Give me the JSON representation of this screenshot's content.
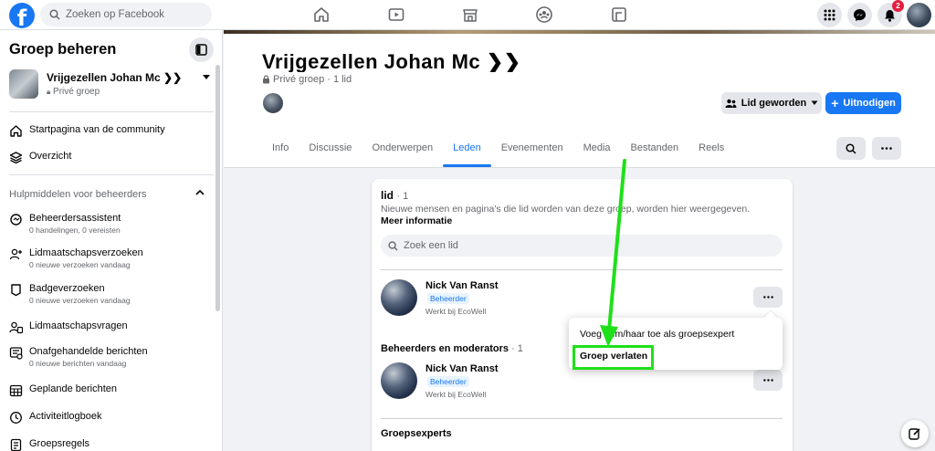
{
  "topbar": {
    "logo_letter": "f",
    "search_placeholder": "Zoeken op Facebook",
    "nav_icons": [
      "home-icon",
      "video-icon",
      "marketplace-icon",
      "groups-icon",
      "gaming-icon"
    ],
    "notification_count": "2"
  },
  "sidebar": {
    "title": "Groep beheren",
    "group": {
      "name": "Vrijgezellen Johan Mc ❯❯",
      "privacy": "Privé groep"
    },
    "items_top": [
      {
        "label": "Startpagina van de community",
        "icon": "home-community-icon"
      },
      {
        "label": "Overzicht",
        "icon": "layers-icon"
      }
    ],
    "section_title": "Hulpmiddelen voor beheerders",
    "tools": [
      {
        "label": "Beheerdersassistent",
        "sub": "0 handelingen, 0 vereisten"
      },
      {
        "label": "Lidmaatschapsverzoeken",
        "sub": "0 nieuwe verzoeken vandaag"
      },
      {
        "label": "Badgeverzoeken",
        "sub": "0 nieuwe verzoeken vandaag"
      },
      {
        "label": "Lidmaatschapsvragen",
        "sub": ""
      },
      {
        "label": "Onafgehandelde berichten",
        "sub": "0 nieuwe berichten vandaag"
      },
      {
        "label": "Geplande berichten",
        "sub": ""
      },
      {
        "label": "Activiteitlogboek",
        "sub": ""
      },
      {
        "label": "Groepsregels",
        "sub": ""
      }
    ]
  },
  "header": {
    "group_title": "Vrijgezellen Johan Mc ❯❯",
    "privacy": "Privé groep",
    "members": "1 lid",
    "member_button": "Lid geworden",
    "invite_button": "Uitnodigen",
    "tabs": [
      "Info",
      "Discussie",
      "Onderwerpen",
      "Leden",
      "Evenementen",
      "Media",
      "Bestanden",
      "Reels"
    ],
    "active_tab": "Leden"
  },
  "members_card": {
    "heading": "lid",
    "count": "· 1",
    "description": "Nieuwe mensen en pagina's die lid worden van deze groep, worden hier weergegeven.",
    "more_link": "Meer informatie",
    "search_placeholder": "Zoek een lid",
    "member": {
      "name": "Nick Van Ranst",
      "role": "Beheerder",
      "work": "Werkt bij EcoWell"
    },
    "admins_heading": "Beheerders en moderators",
    "admins_count": "· 1",
    "experts_heading": "Groepsexperts"
  },
  "context_menu": {
    "items": [
      "Voeg hem/haar toe als groepsexpert",
      "Groep verlaten"
    ],
    "highlighted": "Groep verlaten",
    "highlight_color": "#1fe01a"
  },
  "colors": {
    "accent": "#1877f2",
    "background": "#f0f2f5"
  }
}
